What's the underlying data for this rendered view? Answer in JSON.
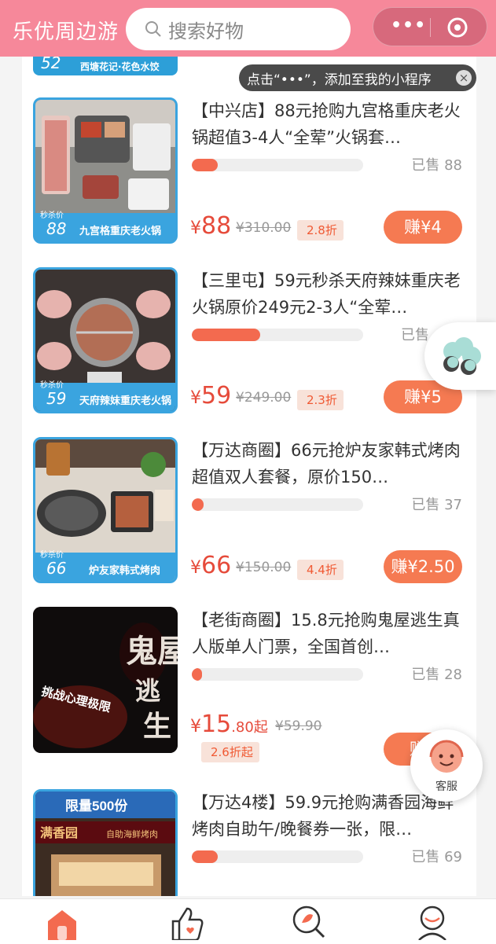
{
  "header": {
    "app_title": "乐优周边游",
    "search_placeholder": "搜索好物",
    "capsule_dots": "•••"
  },
  "tip": {
    "text": "点击“•••”，添加至我的小程序",
    "close": "×"
  },
  "peek_item": {
    "price": "52",
    "name": "西塘花记·花色水饺"
  },
  "items": [
    {
      "title": "【中兴店】88元抢购九宫格重庆老火锅超值3-4人“全荤”火锅套…",
      "sold": "已售 88",
      "progress_pct": 15,
      "price_symbol": "¥",
      "price": "88",
      "original": "¥310.00",
      "discount": "2.8折",
      "earn": "赚¥4",
      "badge_tag": "秒杀价",
      "badge_price": "88",
      "badge_name": "九宫格重庆老火锅"
    },
    {
      "title": "【三里屯】59元秒杀天府辣妹重庆老火锅原价249元2-3人“全荤…",
      "sold": "已售",
      "progress_pct": 40,
      "price_symbol": "¥",
      "price": "59",
      "original": "¥249.00",
      "discount": "2.3折",
      "earn": "赚¥5",
      "badge_tag": "秒杀价",
      "badge_price": "59",
      "badge_name": "天府辣妹重庆老火锅"
    },
    {
      "title": "【万达商圈】66元抢炉友家韩式烤肉超值双人套餐，原价150…",
      "sold": "已售 37",
      "progress_pct": 7,
      "price_symbol": "¥",
      "price": "66",
      "original": "¥150.00",
      "discount": "4.4折",
      "earn": "赚¥2.50",
      "badge_tag": "秒杀价",
      "badge_price": "66",
      "badge_name": "炉友家韩式烤肉"
    },
    {
      "title": "【老街商圈】15.8元抢购鬼屋逃生真人版单人门票，全国首创…",
      "sold": "已售 28",
      "progress_pct": 6,
      "price_symbol": "¥",
      "price": "15",
      "price_decimal": ".80",
      "price_suffix": "起",
      "original": "¥59.90",
      "discount": "2.6折起",
      "earn": "赚¥",
      "poster_text_1": "鬼屋",
      "poster_text_2": "逃",
      "poster_text_3": "生",
      "poster_text_4": "挑战心理极限"
    },
    {
      "title": "【万达4楼】59.9元抢购满香园海鲜烤肉自助午/晚餐券一张，限…",
      "sold": "已售 69",
      "progress_pct": 15,
      "badge_top": "限量500份",
      "shop_name": "满香园",
      "shop_sub": "自助海鲜烤肉"
    }
  ],
  "customer_service": {
    "label": "客服"
  },
  "tabbar": {
    "items": [
      "home-icon",
      "like-icon",
      "discover-icon",
      "profile-icon"
    ]
  },
  "colors": {
    "header": "#f6889a",
    "accent": "#f36a4f",
    "price": "#e64b3b"
  }
}
